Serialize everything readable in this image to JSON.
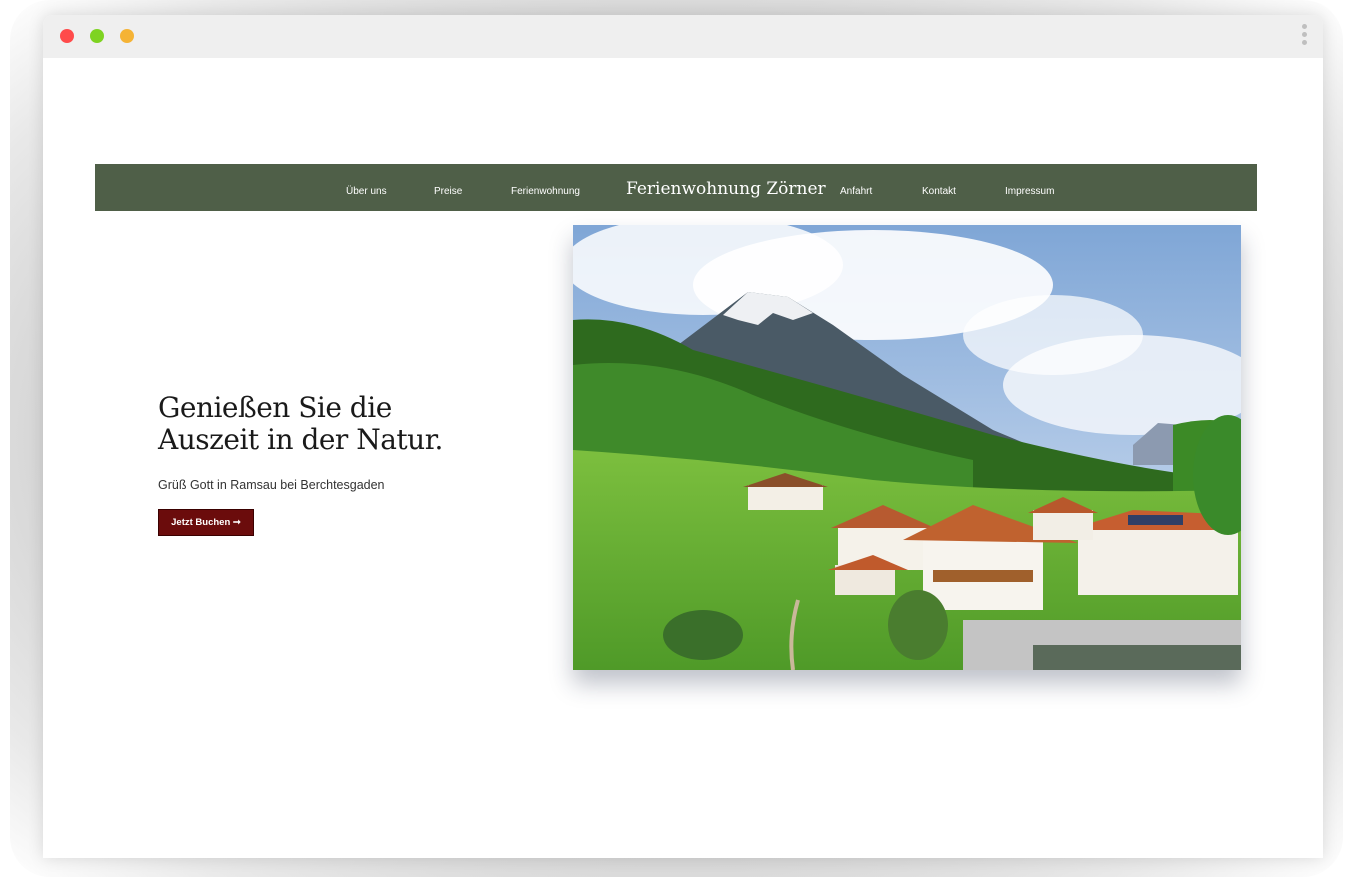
{
  "nav": {
    "left_items": [
      {
        "label": "Über uns"
      },
      {
        "label": "Preise"
      },
      {
        "label": "Ferienwohnung"
      }
    ],
    "brand": "Ferienwohnung Zörner",
    "right_items": [
      {
        "label": "Anfahrt"
      },
      {
        "label": "Kontakt"
      },
      {
        "label": "Impressum"
      }
    ]
  },
  "hero": {
    "headline_line1": "Genießen Sie die",
    "headline_line2": "Auszeit in der Natur.",
    "subline": "Grüß Gott in Ramsau bei Berchtesgaden",
    "cta_label": "Jetzt Buchen ➞"
  },
  "colors": {
    "nav_bg": "#4f5f48",
    "cta_bg": "#6b0c0c",
    "text_dark": "#1a1a1a"
  }
}
